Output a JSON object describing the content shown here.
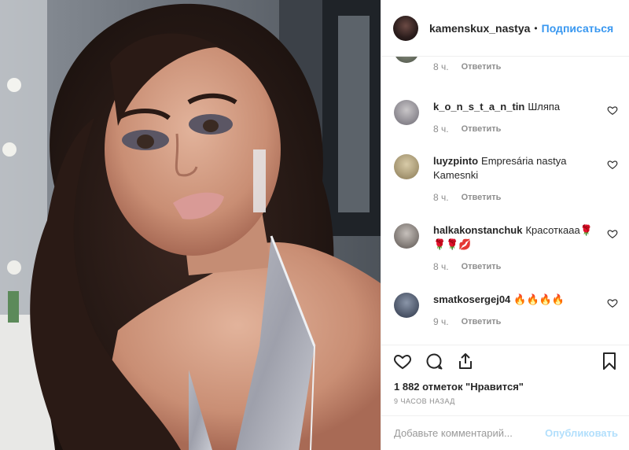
{
  "header": {
    "username": "kamenskux_nastya",
    "separator": "•",
    "follow_label": "Подписаться"
  },
  "comments": [
    {
      "user": "",
      "text": "",
      "time": "8 ч.",
      "reply": "Ответить"
    },
    {
      "user": "k_o_n_s_t_a_n_tin",
      "text": "Шляпа",
      "time": "8 ч.",
      "reply": "Ответить"
    },
    {
      "user": "luyzpinto",
      "text": "Empresária nastya Kamesnki",
      "time": "8 ч.",
      "reply": "Ответить"
    },
    {
      "user": "halkakonstanchuk",
      "text": "Красоткааа🌹🌹🌹💋",
      "time": "8 ч.",
      "reply": "Ответить"
    },
    {
      "user": "smatkosergej04",
      "text": "🔥🔥🔥🔥",
      "time": "9 ч.",
      "reply": "Ответить"
    }
  ],
  "actions": {
    "icons": [
      "heart-icon",
      "comment-icon",
      "share-icon",
      "bookmark-icon"
    ]
  },
  "likes": "1 882 отметок \"Нравится\"",
  "timestamp": "9 часов назад",
  "add_comment": {
    "placeholder": "Добавьте комментарий...",
    "publish_label": "Опубликовать"
  },
  "colors": {
    "accent": "#3897f0",
    "publish_disabled": "#b2dffc",
    "muted": "#8e8e8e"
  }
}
